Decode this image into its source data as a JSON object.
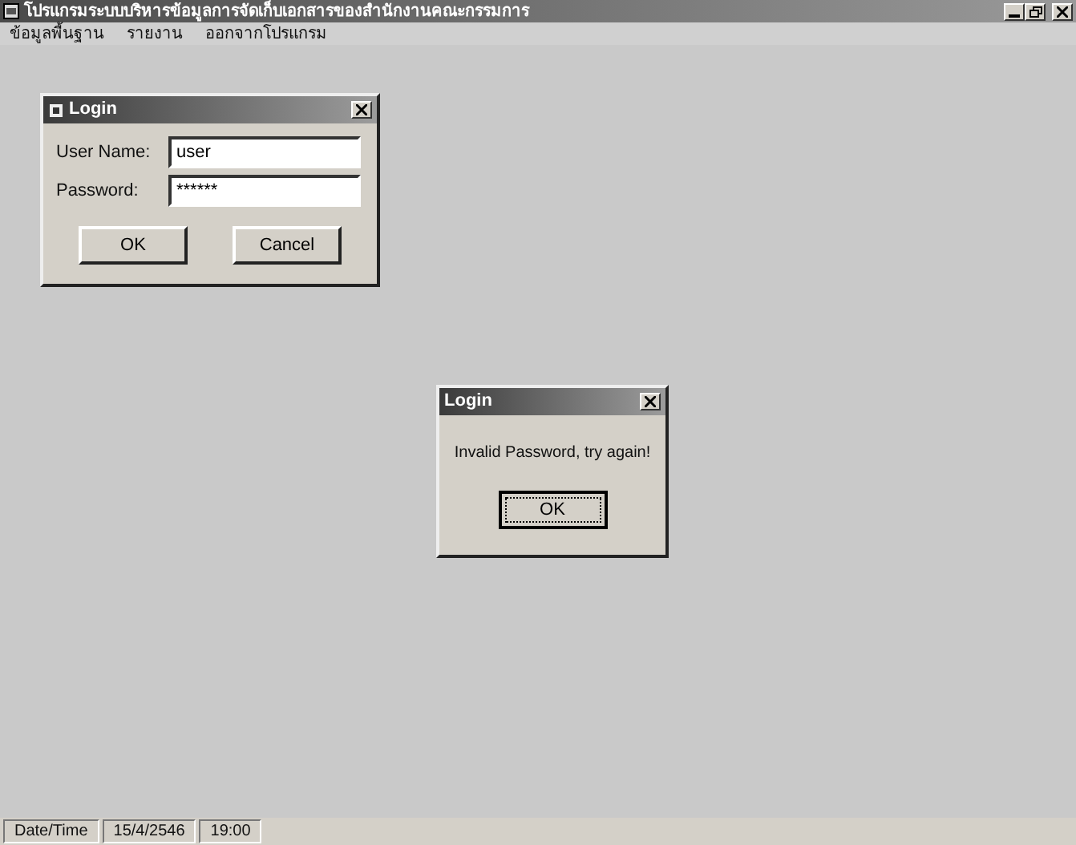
{
  "window": {
    "title": "โปรแกรมระบบบริหารข้อมูลการจัดเก็บเอกสารของสำนักงานคณะกรรมการ"
  },
  "menu": [
    "ข้อมูลพื้นฐาน",
    "รายงาน",
    "ออกจากโปรแกรม"
  ],
  "login_dialog": {
    "title": "Login",
    "fields": [
      {
        "label": "User Name:",
        "value": "user"
      },
      {
        "label": "Password:",
        "value": "******"
      }
    ],
    "buttons": [
      "OK",
      "Cancel"
    ]
  },
  "message_box": {
    "title": "Login",
    "message": "Invalid Password, try again!",
    "button": "OK"
  },
  "status_bar": [
    "Date/Time",
    "15/4/2546",
    "19:00"
  ]
}
